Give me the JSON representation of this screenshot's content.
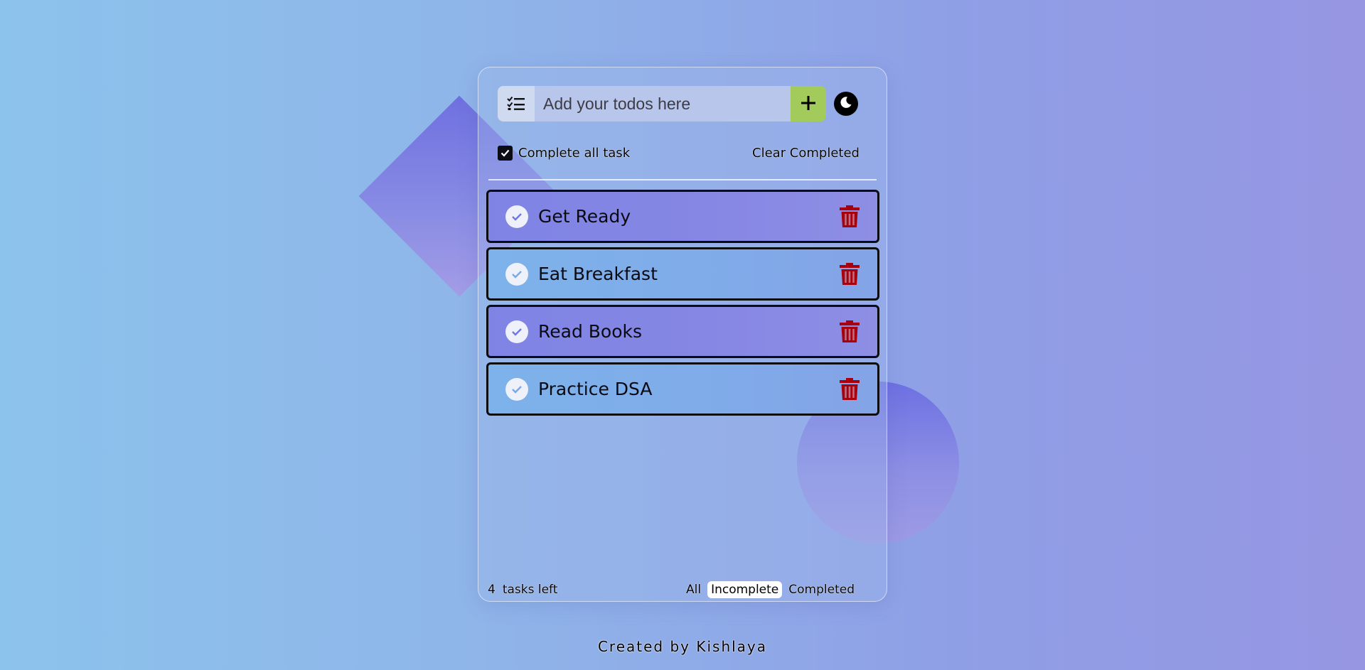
{
  "input": {
    "placeholder": "Add your todos here"
  },
  "icons": {
    "list": "list-check-icon",
    "add": "plus-icon",
    "theme": "moon-icon",
    "task_check": "check-circle-icon",
    "delete": "trash-icon"
  },
  "controls": {
    "complete_all_label": "Complete all task",
    "complete_all_checked": true,
    "clear_completed_label": "Clear Completed"
  },
  "tasks": [
    {
      "text": "Get Ready"
    },
    {
      "text": "Eat Breakfast"
    },
    {
      "text": "Read Books"
    },
    {
      "text": "Practice DSA"
    }
  ],
  "footer": {
    "count": "4",
    "tasks_left_label": "tasks left",
    "filters": [
      {
        "label": "All",
        "active": false
      },
      {
        "label": "Incomplete",
        "active": true
      },
      {
        "label": "Completed",
        "active": false
      }
    ]
  },
  "credit": "Created by Kishlaya",
  "colors": {
    "add_button": "#a3cb5c",
    "trash": "#a8000d",
    "task_border": "#0b0b12"
  }
}
